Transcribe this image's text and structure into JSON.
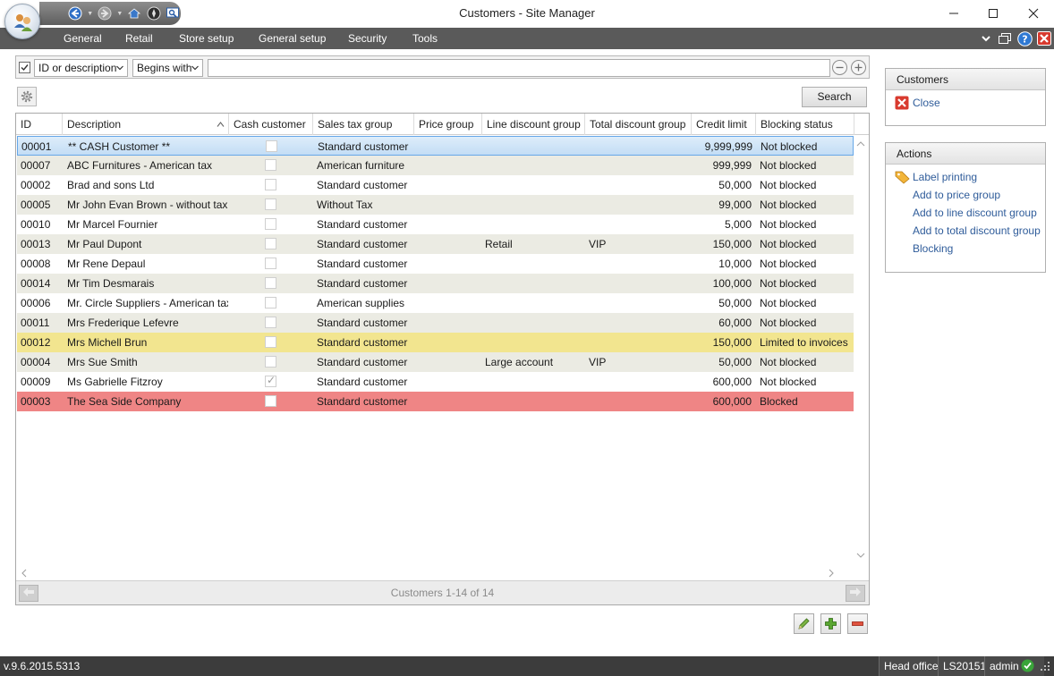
{
  "window": {
    "title": "Customers - Site Manager"
  },
  "menu": {
    "items": [
      "General",
      "Retail",
      "Store setup",
      "General setup",
      "Security",
      "Tools"
    ]
  },
  "filter": {
    "field": "ID or description",
    "operator": "Begins with",
    "value": "",
    "search_label": "Search"
  },
  "grid": {
    "columns": [
      "ID",
      "Description",
      "Cash customer",
      "Sales tax group",
      "Price group",
      "Line discount group",
      "Total discount group",
      "Credit limit",
      "Blocking status"
    ],
    "rows": [
      {
        "id": "00001",
        "description": "** CASH Customer **",
        "cash": false,
        "sales_tax": "Standard customer",
        "price_group": "",
        "line_discount": "",
        "total_discount": "",
        "credit_limit": "9,999,999",
        "blocking": "Not blocked",
        "style": "selected"
      },
      {
        "id": "00007",
        "description": "ABC Furnitures - American tax",
        "cash": false,
        "sales_tax": "American furniture",
        "price_group": "",
        "line_discount": "",
        "total_discount": "",
        "credit_limit": "999,999",
        "blocking": "Not blocked",
        "style": "alt"
      },
      {
        "id": "00002",
        "description": "Brad and sons Ltd",
        "cash": false,
        "sales_tax": "Standard customer",
        "price_group": "",
        "line_discount": "",
        "total_discount": "",
        "credit_limit": "50,000",
        "blocking": "Not blocked",
        "style": "white"
      },
      {
        "id": "00005",
        "description": "Mr John Evan Brown - without tax",
        "cash": false,
        "sales_tax": "Without Tax",
        "price_group": "",
        "line_discount": "",
        "total_discount": "",
        "credit_limit": "99,000",
        "blocking": "Not blocked",
        "style": "alt"
      },
      {
        "id": "00010",
        "description": "Mr Marcel Fournier",
        "cash": false,
        "sales_tax": "Standard customer",
        "price_group": "",
        "line_discount": "",
        "total_discount": "",
        "credit_limit": "5,000",
        "blocking": "Not blocked",
        "style": "white"
      },
      {
        "id": "00013",
        "description": "Mr Paul Dupont",
        "cash": false,
        "sales_tax": "Standard customer",
        "price_group": "",
        "line_discount": "Retail",
        "total_discount": "VIP",
        "credit_limit": "150,000",
        "blocking": "Not blocked",
        "style": "alt"
      },
      {
        "id": "00008",
        "description": "Mr Rene Depaul",
        "cash": false,
        "sales_tax": "Standard customer",
        "price_group": "",
        "line_discount": "",
        "total_discount": "",
        "credit_limit": "10,000",
        "blocking": "Not blocked",
        "style": "white"
      },
      {
        "id": "00014",
        "description": "Mr Tim Desmarais",
        "cash": false,
        "sales_tax": "Standard customer",
        "price_group": "",
        "line_discount": "",
        "total_discount": "",
        "credit_limit": "100,000",
        "blocking": "Not blocked",
        "style": "alt"
      },
      {
        "id": "00006",
        "description": "Mr. Circle Suppliers - American tax",
        "cash": false,
        "sales_tax": "American supplies",
        "price_group": "",
        "line_discount": "",
        "total_discount": "",
        "credit_limit": "50,000",
        "blocking": "Not blocked",
        "style": "white"
      },
      {
        "id": "00011",
        "description": "Mrs Frederique Lefevre",
        "cash": false,
        "sales_tax": "Standard customer",
        "price_group": "",
        "line_discount": "",
        "total_discount": "",
        "credit_limit": "60,000",
        "blocking": "Not blocked",
        "style": "alt"
      },
      {
        "id": "00012",
        "description": "Mrs Michell Brun",
        "cash": false,
        "sales_tax": "Standard customer",
        "price_group": "",
        "line_discount": "",
        "total_discount": "",
        "credit_limit": "150,000",
        "blocking": "Limited to invoices",
        "style": "yellow"
      },
      {
        "id": "00004",
        "description": "Mrs Sue Smith",
        "cash": false,
        "sales_tax": "Standard customer",
        "price_group": "",
        "line_discount": "Large account",
        "total_discount": "VIP",
        "credit_limit": "50,000",
        "blocking": "Not blocked",
        "style": "alt"
      },
      {
        "id": "00009",
        "description": "Ms Gabrielle Fitzroy",
        "cash": true,
        "sales_tax": "Standard customer",
        "price_group": "",
        "line_discount": "",
        "total_discount": "",
        "credit_limit": "600,000",
        "blocking": "Not blocked",
        "style": "white"
      },
      {
        "id": "00003",
        "description": "The Sea Side Company",
        "cash": false,
        "sales_tax": "Standard customer",
        "price_group": "",
        "line_discount": "",
        "total_discount": "",
        "credit_limit": "600,000",
        "blocking": "Blocked",
        "style": "red"
      }
    ],
    "pager_text": "Customers 1-14 of 14"
  },
  "side": {
    "customers_title": "Customers",
    "close_label": "Close",
    "actions_title": "Actions",
    "actions": [
      "Label printing",
      "Add to price group",
      "Add to line discount group",
      "Add to total discount group",
      "Blocking"
    ]
  },
  "status": {
    "version": "v.9.6.2015.5313",
    "location": "Head office",
    "server": "LS20151",
    "user": "admin"
  },
  "colors": {
    "menubar": "#5a5a5a",
    "row_alt": "#ebebe3",
    "row_yellow": "#f2e58f",
    "row_red": "#ef8585",
    "link": "#2f5c9a"
  }
}
